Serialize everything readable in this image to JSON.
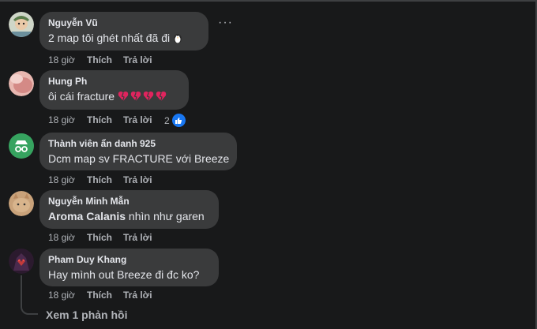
{
  "comments": [
    {
      "author": "Nguyễn Vũ",
      "text": "2 map tôi ghét nhất đã đi",
      "time": "18 giờ",
      "like": "Thích",
      "reply": "Trả lời",
      "more": "···"
    },
    {
      "author": "Hung Ph",
      "text": "ôi cái fracture",
      "time": "18 giờ",
      "like": "Thích",
      "reply": "Trả lời",
      "reaction_count": "2"
    },
    {
      "author": "Thành viên ẩn danh 925",
      "text": "Dcm map sv FRACTURE với Breeze",
      "time": "18 giờ",
      "like": "Thích",
      "reply": "Trả lời"
    },
    {
      "author": "Nguyễn Minh Mẫn",
      "text_bold": "Aroma Calanis",
      "text_rest": " nhìn như garen",
      "time": "18 giờ",
      "like": "Thích",
      "reply": "Trả lời"
    },
    {
      "author": "Pham Duy Khang",
      "text": "Hay mình out Breeze đi đc ko?",
      "time": "18 giờ",
      "like": "Thích",
      "reply": "Trả lời"
    }
  ],
  "view_replies": "Xem 1 phản hồi",
  "icons": {
    "more": "more-dots-icon",
    "like_reaction": "thumbs-up-icon",
    "broken_heart": "broken-heart-emoji",
    "penguin": "penguin-emoji",
    "incognito": "incognito-icon"
  },
  "colors": {
    "background": "#18191a",
    "bubble": "#3a3b3c",
    "text": "#e4e6eb",
    "secondary": "#b0b3b8",
    "like_blue": "#1877f2",
    "heart_red": "#e0245e"
  }
}
